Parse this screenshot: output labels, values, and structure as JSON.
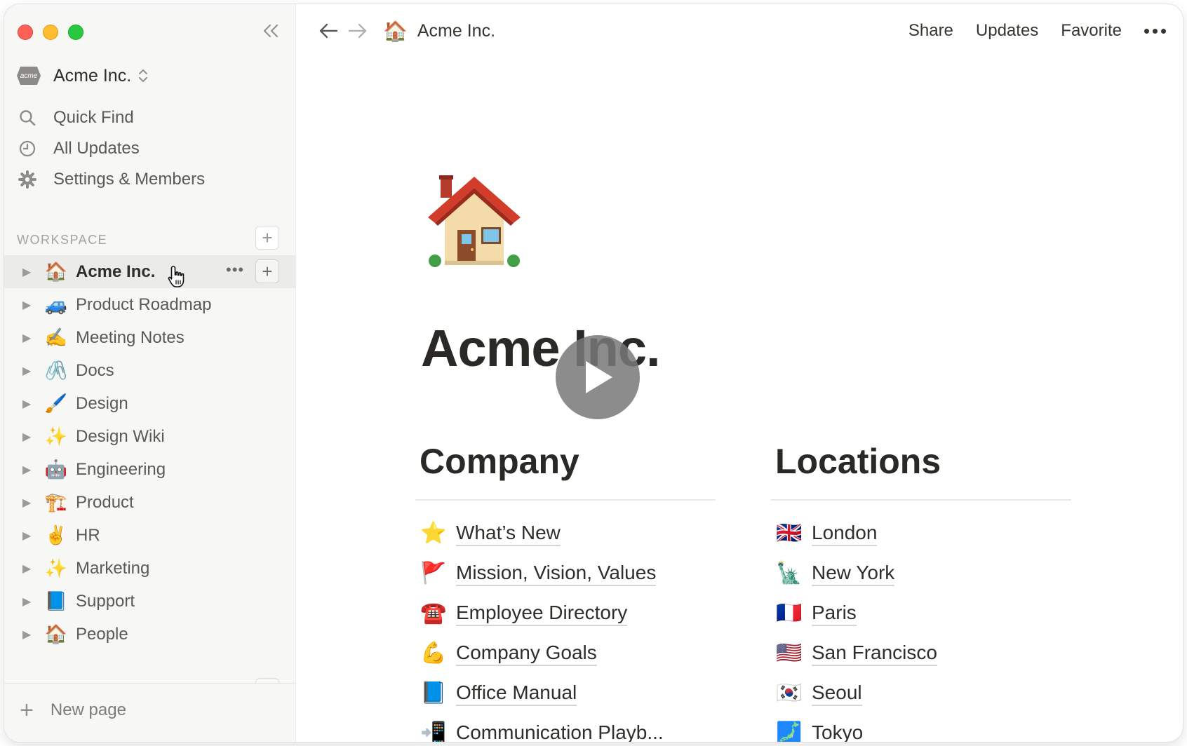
{
  "window": {
    "traffic_lights": [
      "close",
      "minimize",
      "maximize"
    ]
  },
  "sidebar": {
    "workspace_name": "Acme Inc.",
    "workspace_logo_text": "acme",
    "menu": [
      {
        "label": "Quick Find",
        "icon": "search-icon"
      },
      {
        "label": "All Updates",
        "icon": "clock-icon"
      },
      {
        "label": "Settings & Members",
        "icon": "gear-icon"
      }
    ],
    "section_title": "WORKSPACE",
    "pages": [
      {
        "label": "Acme Inc.",
        "emoji": "🏠",
        "active": true
      },
      {
        "label": "Product Roadmap",
        "emoji": "🚙"
      },
      {
        "label": "Meeting Notes",
        "emoji": "✍️"
      },
      {
        "label": "Docs",
        "emoji": "🖇️"
      },
      {
        "label": "Design",
        "emoji": "🖌️"
      },
      {
        "label": "Design Wiki",
        "emoji": "✨"
      },
      {
        "label": "Engineering",
        "emoji": "🤖"
      },
      {
        "label": "Product",
        "emoji": "🏗️"
      },
      {
        "label": "HR",
        "emoji": "✌️"
      },
      {
        "label": "Marketing",
        "emoji": "✨"
      },
      {
        "label": "Support",
        "emoji": "📘"
      },
      {
        "label": "People",
        "emoji": "🏠"
      }
    ],
    "new_page_label": "New page"
  },
  "topbar": {
    "breadcrumb_emoji": "🏠",
    "breadcrumb": "Acme Inc.",
    "actions": {
      "share": "Share",
      "updates": "Updates",
      "favorite": "Favorite"
    }
  },
  "page": {
    "icon_emoji": "🏠",
    "title": "Acme Inc.",
    "columns": [
      {
        "title": "Company",
        "links": [
          {
            "emoji": "⭐",
            "label": "What’s New"
          },
          {
            "emoji": "🚩",
            "label": "Mission, Vision, Values"
          },
          {
            "emoji": "☎️",
            "label": "Employee Directory"
          },
          {
            "emoji": "💪",
            "label": "Company Goals"
          },
          {
            "emoji": "📘",
            "label": "Office Manual"
          },
          {
            "emoji": "📲",
            "label": "Communication Playb..."
          }
        ]
      },
      {
        "title": "Locations",
        "links": [
          {
            "emoji": "🇬🇧",
            "label": "London"
          },
          {
            "emoji": "🗽",
            "label": "New York"
          },
          {
            "emoji": "🇫🇷",
            "label": "Paris"
          },
          {
            "emoji": "🇺🇸",
            "label": "San Francisco"
          },
          {
            "emoji": "🇰🇷",
            "label": "Seoul"
          },
          {
            "emoji": "🗾",
            "label": "Tokyo"
          }
        ]
      }
    ]
  },
  "video_overlay": {
    "icon": "play-icon"
  },
  "colors": {
    "sidebar_bg": "#f7f7f5",
    "active_row_bg": "#ebebea",
    "text": "#37352f",
    "traffic_red": "#fe5f57",
    "traffic_yellow": "#febc2e",
    "traffic_green": "#28c840"
  }
}
